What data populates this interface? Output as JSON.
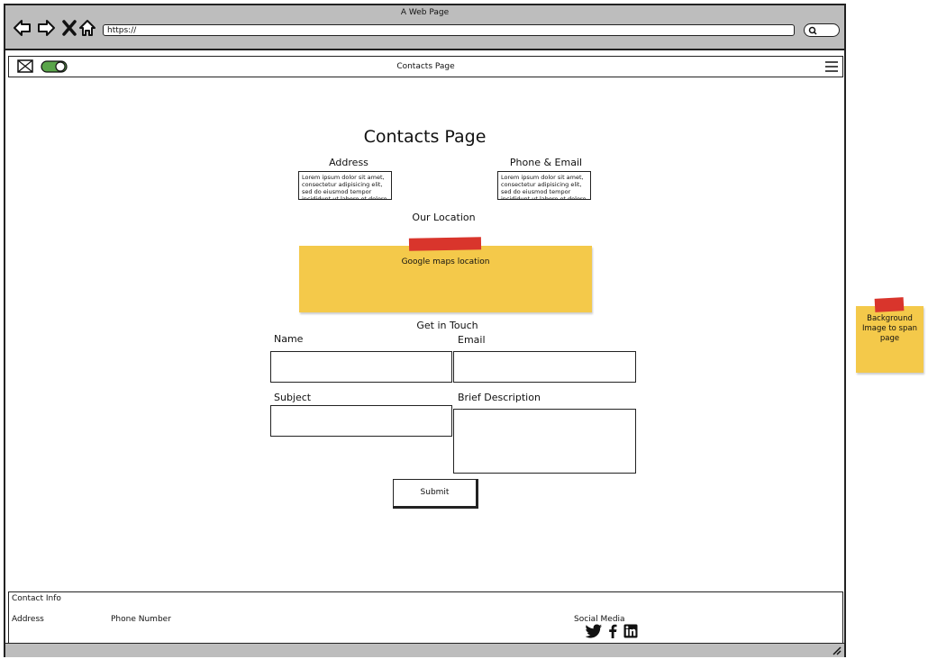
{
  "browser": {
    "title": "A Web Page",
    "url": "https://"
  },
  "appbar": {
    "title": "Contacts Page"
  },
  "main": {
    "heading": "Contacts Page",
    "address_label": "Address",
    "address_text": "Lorem ipsum dolor sit amet, consectetur adipisicing elit, sed do eiusmod tempor incididunt ut labore et dolore",
    "contact_label": "Phone & Email",
    "contact_text": "Lorem ipsum dolor sit amet, consectetur adipisicing elit, sed do eiusmod tempor incididunt ut labore et dolore",
    "location_label": "Our Location",
    "map_note": "Google maps location",
    "touch_label": "Get in Touch",
    "name_label": "Name",
    "email_label": "Email",
    "subject_label": "Subject",
    "description_label": "Brief Description",
    "submit_label": "Submit"
  },
  "footer": {
    "contact_info": "Contact Info",
    "address": "Address",
    "phone": "Phone Number",
    "social": "Social Media"
  },
  "side_note": "Background Image to span page",
  "colors": {
    "chrome": "#bdbdbd",
    "toggle": "#5aa54a",
    "sticky": "#f4c94a",
    "tape": "#d9352c"
  }
}
